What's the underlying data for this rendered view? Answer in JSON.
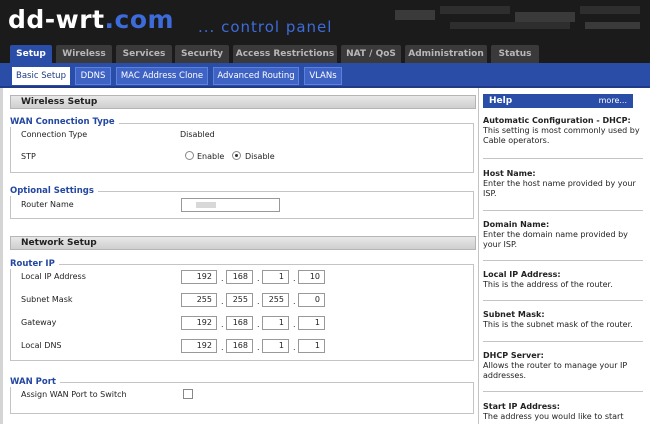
{
  "header": {
    "logo_main": "dd-wrt",
    "logo_tld": ".com",
    "tagline": "... control panel"
  },
  "main_tabs": [
    "Setup",
    "Wireless",
    "Services",
    "Security",
    "Access Restrictions",
    "NAT / QoS",
    "Administration",
    "Status"
  ],
  "sub_tabs": [
    "Basic Setup",
    "DDNS",
    "MAC Address Clone",
    "Advanced Routing",
    "VLANs"
  ],
  "wireless_setup": {
    "section_title": "Wireless Setup",
    "wan": {
      "legend": "WAN Connection Type",
      "connection_type_label": "Connection Type",
      "connection_type_value": "Disabled",
      "stp_label": "STP",
      "stp_enable": "Enable",
      "stp_disable": "Disable",
      "stp_selected": "Disable"
    },
    "optional": {
      "legend": "Optional Settings",
      "router_name_label": "Router Name"
    }
  },
  "network_setup": {
    "section_title": "Network Setup",
    "router_ip": {
      "legend": "Router IP",
      "local_ip_label": "Local IP Address",
      "local_ip": [
        "192",
        "168",
        "1",
        "10"
      ],
      "subnet_label": "Subnet Mask",
      "subnet": [
        "255",
        "255",
        "255",
        "0"
      ],
      "gateway_label": "Gateway",
      "gateway": [
        "192",
        "168",
        "1",
        "1"
      ],
      "dns_label": "Local DNS",
      "dns": [
        "192",
        "168",
        "1",
        "1"
      ]
    },
    "wan_port": {
      "legend": "WAN Port",
      "assign_label": "Assign WAN Port to Switch",
      "assign_checked": false
    }
  },
  "help": {
    "title": "Help",
    "more": "more...",
    "items": [
      {
        "title": "Automatic Configuration - DHCP:",
        "desc": "This setting is most commonly used by Cable operators."
      },
      {
        "title": "Host Name:",
        "desc": "Enter the host name provided by your ISP."
      },
      {
        "title": "Domain Name:",
        "desc": "Enter the domain name provided by your ISP."
      },
      {
        "title": "Local IP Address:",
        "desc": "This is the address of the router."
      },
      {
        "title": "Subnet Mask:",
        "desc": "This is the subnet mask of the router."
      },
      {
        "title": "DHCP Server:",
        "desc": "Allows the router to manage your IP addresses."
      },
      {
        "title": "Start IP Address:",
        "desc": "The address you would like to start"
      }
    ]
  },
  "colors": {
    "header_bg": "#1b1b1b",
    "accent_blue": "#2a4da8",
    "legend_blue": "#2447a0"
  }
}
